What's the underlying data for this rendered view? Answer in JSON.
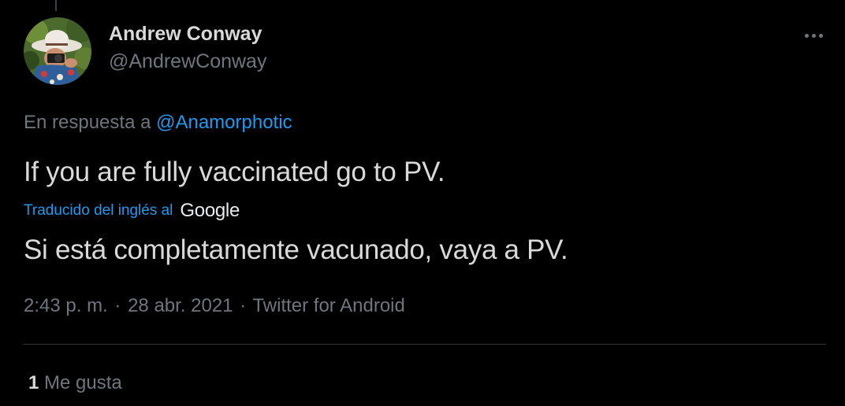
{
  "author": {
    "display_name": "Andrew Conway",
    "handle": "@AndrewConway"
  },
  "reply": {
    "prefix": "En respuesta a",
    "mention": "@Anamorphotic"
  },
  "tweet": {
    "text": "If you are fully vaccinated go to PV."
  },
  "translation": {
    "label": "Traducido del inglés al",
    "provider": "Google",
    "text": "Si está completamente vacunado, vaya a PV."
  },
  "meta": {
    "time": "2:43 p. m.",
    "separator": "·",
    "date": "28 abr. 2021",
    "source": "Twitter for Android"
  },
  "stats": {
    "likes_count": "1",
    "likes_label": "Me gusta"
  },
  "icons": {
    "more": "more-horizontal-icon"
  },
  "colors": {
    "background": "#000000",
    "text_primary": "#d9d9d9",
    "text_secondary": "#6e767d",
    "accent": "#1d9bf0",
    "divider": "#2f3336"
  }
}
